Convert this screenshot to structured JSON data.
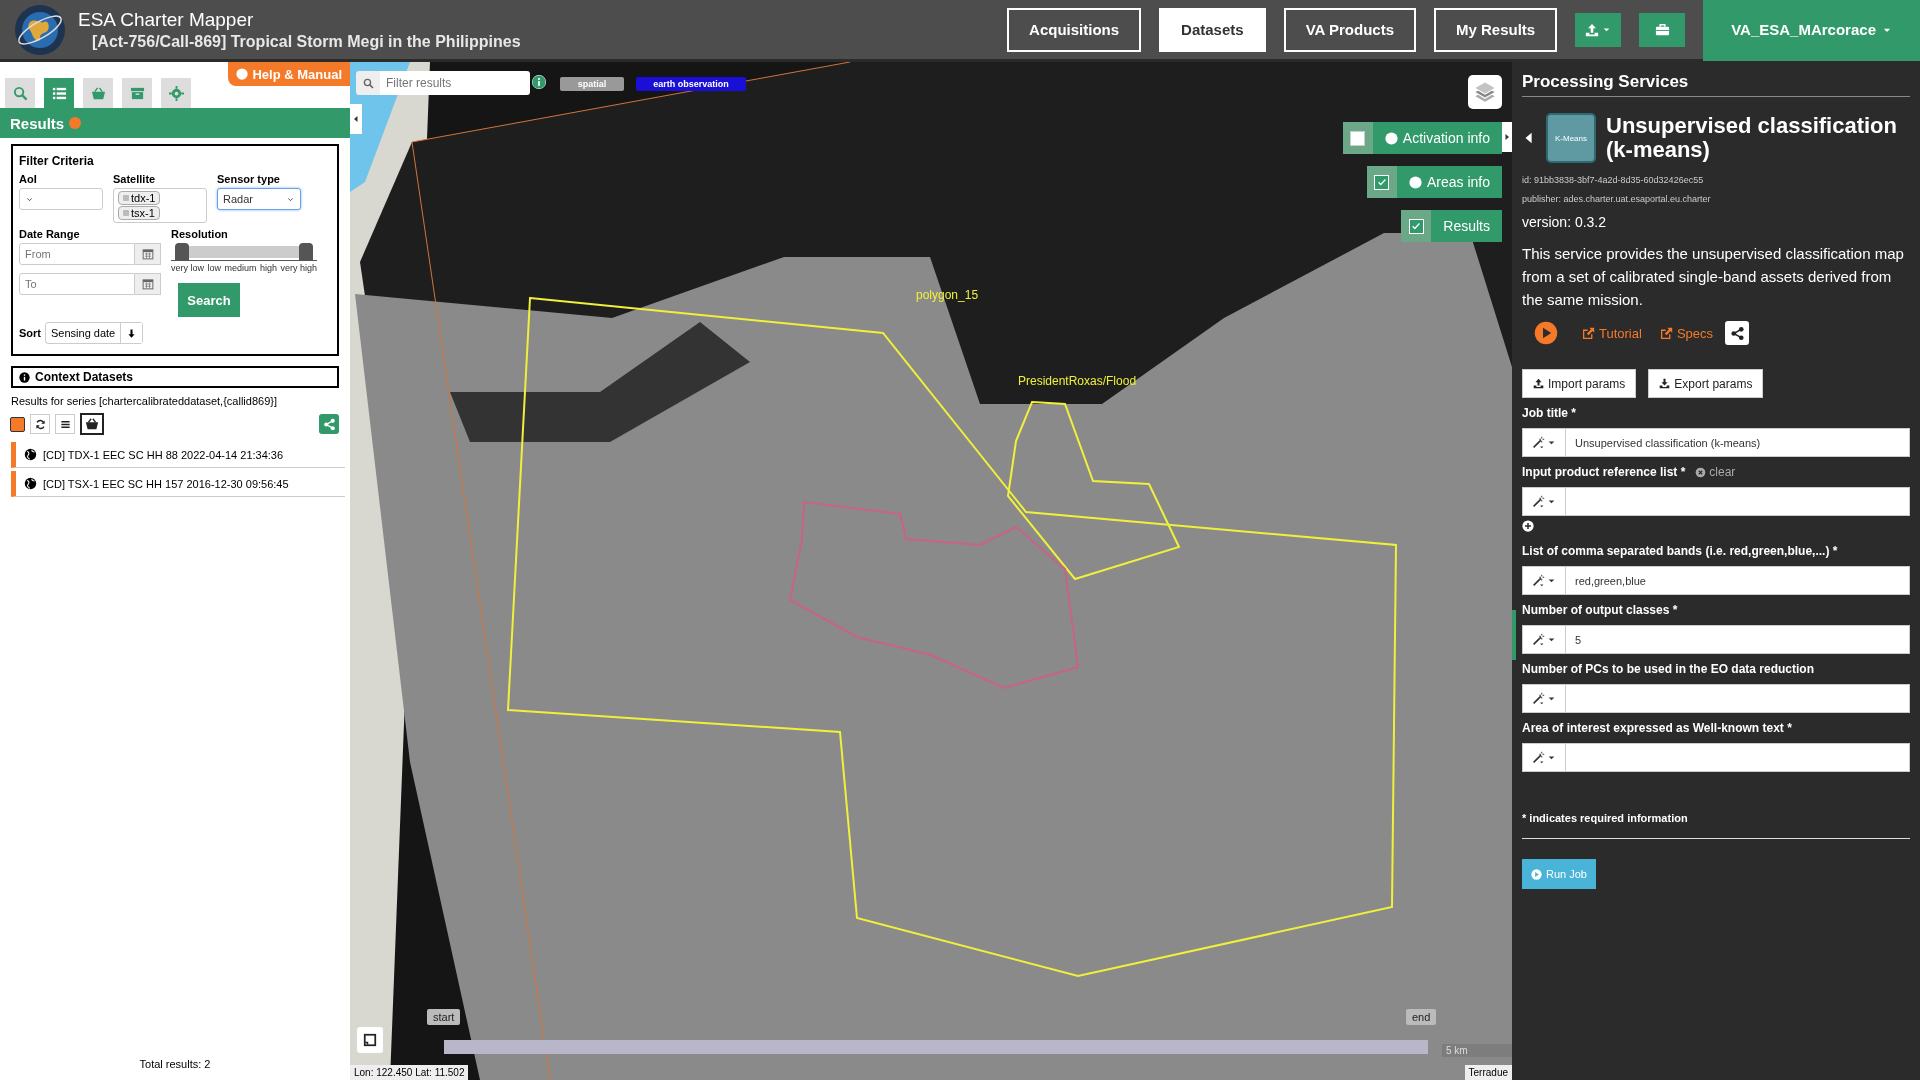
{
  "header": {
    "title": "ESA Charter Mapper",
    "subtitle": "[Act-756/Call-869] Tropical Storm Megi in the Philippines",
    "nav": [
      {
        "label": "Acquisitions",
        "selected": false
      },
      {
        "label": "Datasets",
        "selected": true
      },
      {
        "label": "VA Products",
        "selected": false
      },
      {
        "label": "My Results",
        "selected": false
      }
    ],
    "user": "VA_ESA_MArcorace"
  },
  "left_panel": {
    "help": "Help & Manual",
    "tabs": [
      {
        "kind": "search",
        "selected": false
      },
      {
        "kind": "list",
        "selected": true
      },
      {
        "kind": "basket",
        "selected": false
      },
      {
        "kind": "archive",
        "selected": false
      },
      {
        "kind": "settings",
        "selected": false
      }
    ],
    "section_title": "Results",
    "filter": {
      "title": "Filter Criteria",
      "aoi_label": "AoI",
      "satellite_label": "Satellite",
      "satellites": [
        "tdx-1",
        "tsx-1"
      ],
      "sensor_label": "Sensor type",
      "sensor_value": "Radar",
      "date_label": "Date Range",
      "from_placeholder": "From",
      "to_placeholder": "To",
      "resolution_label": "Resolution",
      "resolution_ticks": [
        {
          "label": "very low",
          "selected": true
        },
        {
          "label": "low",
          "selected": false
        },
        {
          "label": "medium",
          "selected": false
        },
        {
          "label": "high",
          "selected": false
        },
        {
          "label": "very high",
          "selected": true
        }
      ],
      "search_button": "Search",
      "sort_label": "Sort",
      "sort_value": "Sensing date"
    },
    "context_title": "Context Datasets",
    "select_all": {
      "checked": true
    },
    "series_text": "Results for series [chartercalibrateddataset,{callid869}]",
    "results": [
      {
        "label": "[CD] TDX-1 EEC SC HH 88 2022-04-14 21:34:36",
        "color": "#f47a2a"
      },
      {
        "label": "[CD] TSX-1 EEC SC HH 157 2016-12-30 09:56:45",
        "color": "#f47a2a"
      }
    ],
    "total": "Total results: 2"
  },
  "map": {
    "search_placeholder": "Filter results",
    "tags": [
      {
        "label": "spatial",
        "color": "#999999"
      },
      {
        "label": "earth observation",
        "color": "#1a0fd6"
      }
    ],
    "layers": [
      {
        "label": "Activation info",
        "checked": false,
        "info": true
      },
      {
        "label": "Areas info",
        "checked": true,
        "info": true
      },
      {
        "label": "Results",
        "checked": true,
        "info": false
      }
    ],
    "polygons": [
      {
        "label": "polygon_15",
        "color": "#f0f03c"
      },
      {
        "label": "PresidentRoxas/Flood",
        "color": "#f0f03c"
      },
      {
        "color": "#c86482"
      }
    ],
    "timeline": {
      "start": "start",
      "end": "end"
    },
    "scale": "5 km",
    "coords": "Lon: 122.450 Lat: 11.502",
    "attribution": "Terradue"
  },
  "right_panel": {
    "title": "Processing Services",
    "service_icon_text": "K-Means",
    "service_title": "Unsupervised classification (k-means)",
    "id": "id: 91bb3838-3bf7-4a2d-8d35-60d32426ec55",
    "publisher": "publisher: ades.charter.uat.esaportal.eu.charter",
    "version": "version: 0.3.2",
    "description": "This service provides the unsupervised classification map from a set of calibrated single-band assets derived from the same mission.",
    "tutorial": "Tutorial",
    "specs": "Specs",
    "import": "Import params",
    "export": "Export params",
    "fields": [
      {
        "label": "Job title *",
        "value": "Unsupervised classification (k-means)"
      },
      {
        "label": "Input product reference list *",
        "clear": "clear",
        "addable": true
      },
      {
        "label": "List of comma separated bands (i.e. red,green,blue,...) *",
        "value": "red,green,blue"
      },
      {
        "label": "Number of output classes *",
        "value": "5"
      },
      {
        "label": "Number of PCs to be used in the EO data reduction"
      },
      {
        "label": "Area of interest expressed as Well-known text *"
      }
    ],
    "required_note": "* indicates required information",
    "run": "Run Job"
  }
}
